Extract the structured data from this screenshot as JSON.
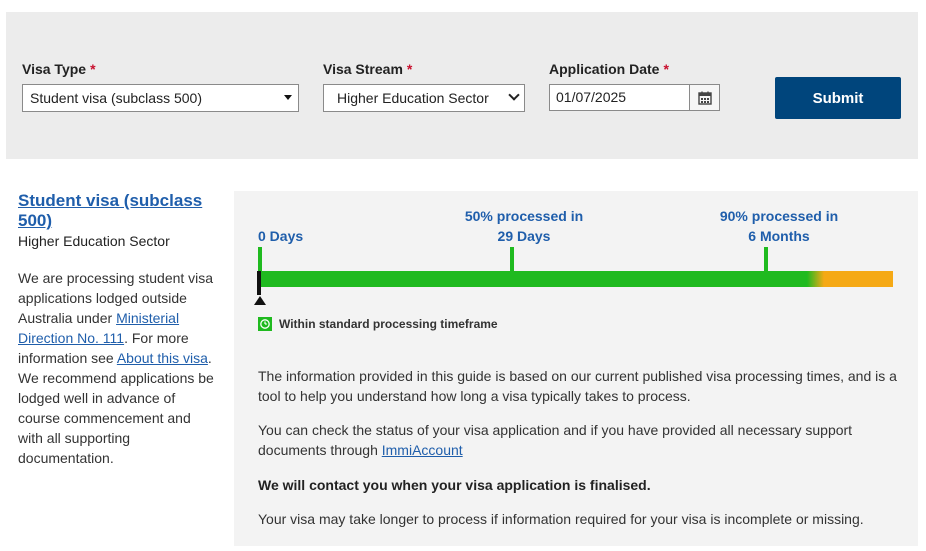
{
  "form": {
    "visa_type_label": "Visa Type",
    "visa_type_value": "Student visa (subclass 500)",
    "visa_stream_label": "Visa Stream",
    "visa_stream_value": "Higher Education Sector",
    "app_date_label": "Application Date",
    "app_date_value": "01/07/2025",
    "required_mark": "*",
    "submit_label": "Submit"
  },
  "sidebar": {
    "title": "Student visa (subclass 500)",
    "stream": "Higher Education Sector",
    "note_1": "We are processing student visa applications lodged outside Australia under ",
    "link_1": "Ministerial Direction No. 111",
    "note_2": ". For more information see ",
    "link_2": "About this visa",
    "note_3": ". We recommend applications be lodged well in advance of course commencement and with all supporting documentation."
  },
  "timeline": {
    "start_label": "0 Days",
    "m50_line1": "50% processed in",
    "m50_line2": "29 Days",
    "m90_line1": "90% processed in",
    "m90_line2": "6 Months",
    "legend": "Within standard processing timeframe",
    "colors": {
      "within": "#1fba1f",
      "beyond": "#f5a915",
      "accent": "#1f5eab"
    }
  },
  "info": {
    "para_1": "The information provided in this guide is based on our current published visa processing times, and is a tool to help you understand how long a visa typically takes to process.",
    "para_2_text": "You can check the status of your visa application and if you have provided all necessary support documents through ",
    "para_2_link": "ImmiAccount",
    "para_3": "We will contact you when your visa application is finalised.",
    "para_4": "Your visa may take longer to process if information required for your visa is incomplete or missing."
  },
  "icons": [
    "chevron-down-icon",
    "calendar-icon",
    "clock-icon"
  ]
}
